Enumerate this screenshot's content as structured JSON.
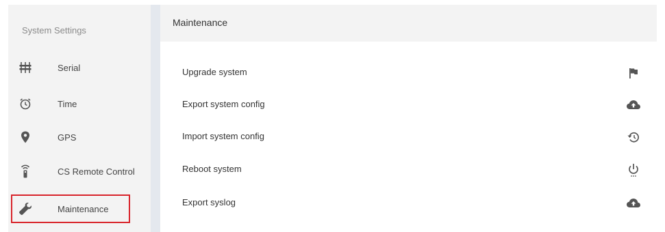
{
  "sidebar": {
    "title": "System Settings",
    "items": [
      {
        "label": "Serial",
        "icon": "serial-ports-icon"
      },
      {
        "label": "Time",
        "icon": "time-icon"
      },
      {
        "label": "GPS",
        "icon": "location-pin-icon"
      },
      {
        "label": "CS Remote Control",
        "icon": "remote-control-icon"
      },
      {
        "label": "Maintenance",
        "icon": "wrench-icon",
        "selected": true
      }
    ]
  },
  "main": {
    "title": "Maintenance",
    "rows": [
      {
        "label": "Upgrade system",
        "icon": "flag-icon"
      },
      {
        "label": "Export system config",
        "icon": "cloud-upload-icon"
      },
      {
        "label": "Import system config",
        "icon": "restore-icon"
      },
      {
        "label": "Reboot system",
        "icon": "power-icon"
      },
      {
        "label": "Export syslog",
        "icon": "cloud-upload-icon"
      }
    ]
  },
  "colors": {
    "sidebar_bg": "#f3f3f3",
    "divider": "#e4e8ee",
    "selection_border": "#d8232a",
    "icon": "#555555"
  }
}
